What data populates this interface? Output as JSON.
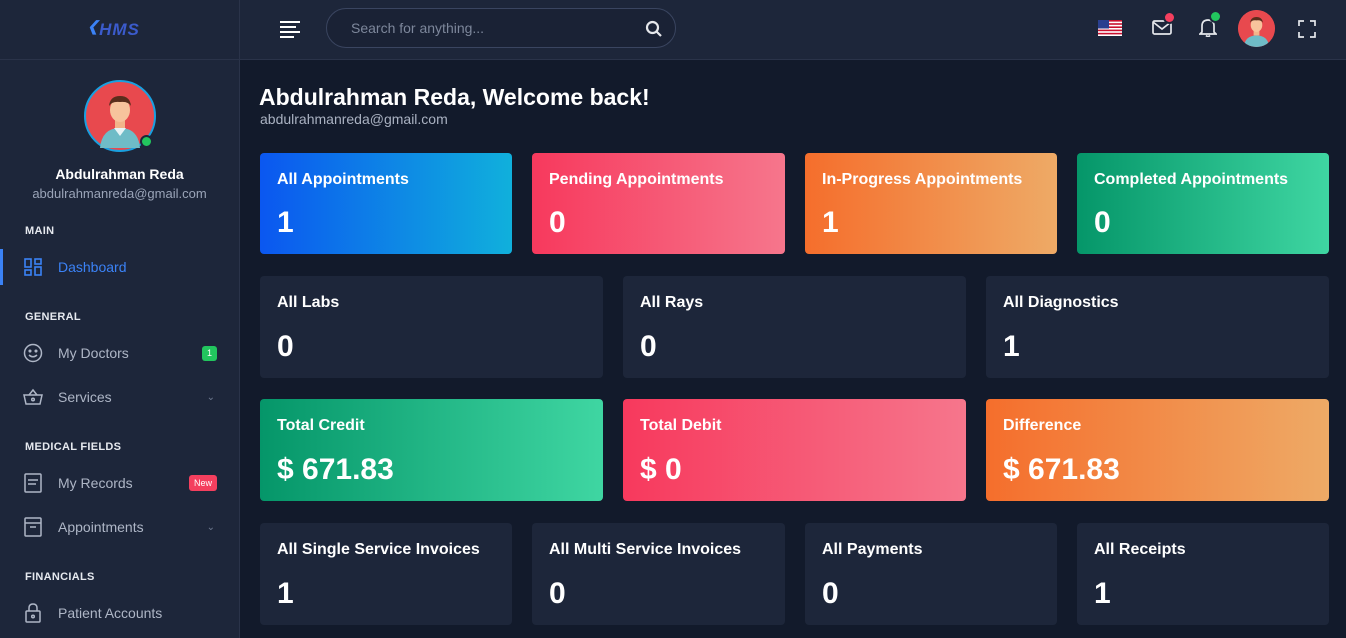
{
  "app": {
    "logo_text": "HMS"
  },
  "user": {
    "name": "Abdulrahman Reda",
    "email": "abdulrahmanreda@gmail.com"
  },
  "sidebar": {
    "sections": [
      {
        "title": "MAIN"
      },
      {
        "title": "GENERAL"
      },
      {
        "title": "MEDICAL FIELDS"
      },
      {
        "title": "FINANCIALS"
      }
    ],
    "items": [
      {
        "label": "Dashboard",
        "icon": "dashboard-grid-icon",
        "active": true
      },
      {
        "label": "My Doctors",
        "icon": "smiley-face-icon",
        "badge": "1"
      },
      {
        "label": "Services",
        "icon": "basket-icon",
        "has_dropdown": true
      },
      {
        "label": "My Records",
        "icon": "document-icon",
        "badge": "New"
      },
      {
        "label": "Appointments",
        "icon": "archive-box-icon",
        "has_dropdown": true
      },
      {
        "label": "Patient Accounts",
        "icon": "lock-icon"
      }
    ]
  },
  "topbar": {
    "search": {
      "placeholder": "Search for anything..."
    },
    "icons": [
      "menu-icon",
      "us-flag-icon",
      "mail-icon",
      "bell-icon",
      "avatar",
      "fullscreen-icon"
    ]
  },
  "welcome": {
    "heading": "Abdulrahman Reda, Welcome back!",
    "email": "abdulrahmanreda@gmail.com"
  },
  "cards": {
    "row1": [
      {
        "title": "All Appointments",
        "value": "1"
      },
      {
        "title": "Pending Appointments",
        "value": "0"
      },
      {
        "title": "In-Progress Appointments",
        "value": "1"
      },
      {
        "title": "Completed Appointments",
        "value": "0"
      }
    ],
    "row2": [
      {
        "title": "All Labs",
        "value": "0"
      },
      {
        "title": "All Rays",
        "value": "0"
      },
      {
        "title": "All Diagnostics",
        "value": "1"
      }
    ],
    "row3": [
      {
        "title": "Total Credit",
        "value": "$ 671.83"
      },
      {
        "title": "Total Debit",
        "value": "$ 0"
      },
      {
        "title": "Difference",
        "value": "$ 671.83"
      }
    ],
    "row4": [
      {
        "title": "All Single Service Invoices",
        "value": "1"
      },
      {
        "title": "All Multi Service Invoices",
        "value": "0"
      },
      {
        "title": "All Payments",
        "value": "0"
      },
      {
        "title": "All Receipts",
        "value": "1"
      }
    ]
  },
  "colors": {
    "accent": "#3b82f6",
    "sidebar_bg": "#1d263a",
    "page_bg": "#121a2b",
    "success": "#22c55e",
    "danger": "#f43f5e"
  }
}
